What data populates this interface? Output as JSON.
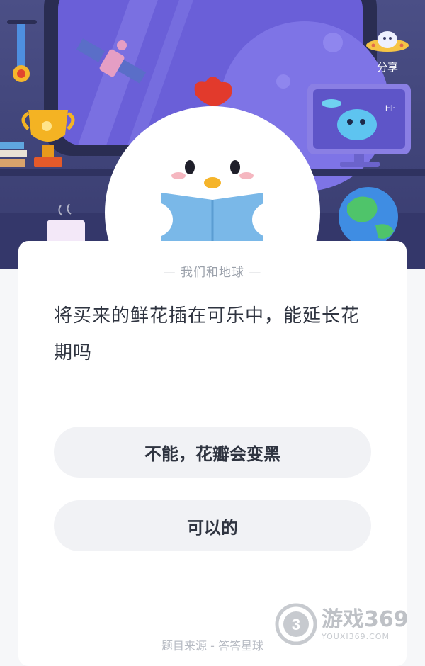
{
  "header": {
    "share_label": "分享",
    "monitor_text": "Hi~"
  },
  "card": {
    "category": "— 我们和地球 —",
    "question": "将买来的鲜花插在可乐中，能延长花期吗",
    "options": [
      {
        "label": "不能，花瓣会变黑"
      },
      {
        "label": "可以的"
      }
    ],
    "source": "题目来源 - 答答星球"
  },
  "watermark": {
    "number": "3",
    "title": "游戏369",
    "url": "YOUXI369.COM"
  },
  "colors": {
    "scene_bg": "#4b4f86",
    "window_frame": "#2c2f55",
    "window_glass": "#6b5ed6",
    "chick_comb": "#e23a2c",
    "book": "#7ab8e8",
    "card_bg": "#ffffff",
    "option_bg": "#f1f2f5",
    "text_primary": "#2f3440",
    "text_secondary": "#9aa0aa"
  }
}
